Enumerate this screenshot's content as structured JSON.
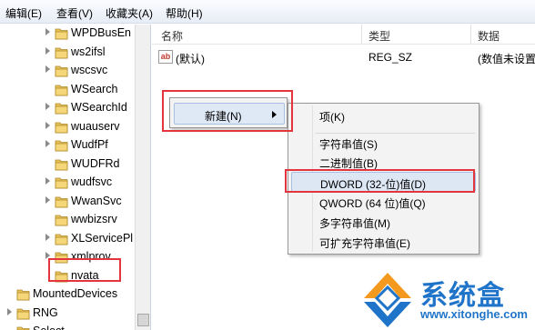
{
  "menubar": {
    "items": [
      "编辑(E)",
      "查看(V)",
      "收藏夹(A)",
      "帮助(H)"
    ]
  },
  "tree": {
    "items": [
      {
        "label": "WPDBusEn",
        "expandable": true
      },
      {
        "label": "ws2ifsl",
        "expandable": true
      },
      {
        "label": "wscsvc",
        "expandable": true
      },
      {
        "label": "WSearch",
        "expandable": false
      },
      {
        "label": "WSearchId",
        "expandable": true
      },
      {
        "label": "wuauserv",
        "expandable": true
      },
      {
        "label": "WudfPf",
        "expandable": true
      },
      {
        "label": "WUDFRd",
        "expandable": false
      },
      {
        "label": "wudfsvc",
        "expandable": true
      },
      {
        "label": "WwanSvc",
        "expandable": true
      },
      {
        "label": "wwbizsrv",
        "expandable": false
      },
      {
        "label": "XLServicePl",
        "expandable": true
      },
      {
        "label": "xmlprov",
        "expandable": true
      },
      {
        "label": "nvata",
        "expandable": false,
        "selected": true
      },
      {
        "label": "MountedDevices",
        "expandable": false,
        "level": 1
      },
      {
        "label": "RNG",
        "expandable": true,
        "level": 1
      },
      {
        "label": "Select",
        "expandable": false,
        "level": 1
      }
    ]
  },
  "list": {
    "headers": {
      "name": "名称",
      "type": "类型",
      "data": "数据"
    },
    "rows": [
      {
        "name": "(默认)",
        "type": "REG_SZ",
        "data": "(数值未设置"
      }
    ]
  },
  "context_menu": {
    "new_label": "新建(N)",
    "submenu": {
      "items": [
        {
          "label": "项(K)"
        },
        {
          "label": "字符串值(S)"
        },
        {
          "label": "二进制值(B)"
        },
        {
          "label": "DWORD (32-位)值(D)",
          "highlighted": true
        },
        {
          "label": "QWORD (64 位)值(Q)"
        },
        {
          "label": "多字符串值(M)"
        },
        {
          "label": "可扩充字符串值(E)"
        }
      ]
    }
  },
  "logo": {
    "brand": "系统盒",
    "url": "www.xitonghe.com"
  },
  "colors": {
    "highlight_red": "#e5353c",
    "logo_blue": "#1f74c9",
    "folder_yellow": "#e8c35a"
  }
}
